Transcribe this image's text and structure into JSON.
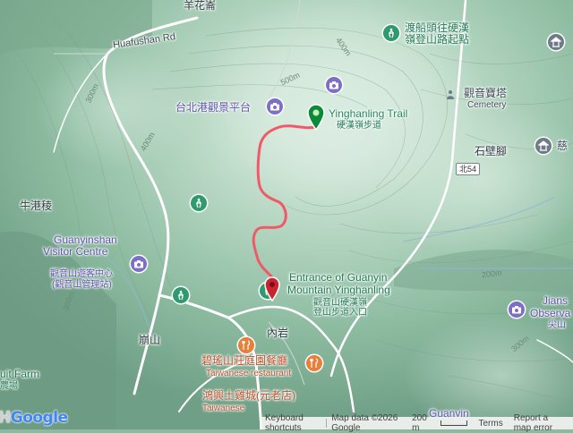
{
  "map": {
    "area_names": {
      "yanghua": "羊花崙",
      "niugang": "牛港稜",
      "shishan": "石壁腳",
      "bengshan": "崩山",
      "neiyan": "內岩"
    },
    "roads": {
      "huafushan_rd": "Huafushan Rd",
      "route_54": "北54"
    },
    "contours": [
      "500m",
      "400m",
      "300m",
      "400m",
      "300m",
      "300m",
      "400m",
      "200m",
      "300m"
    ],
    "pois": {
      "ferry_trailhead_line1": "渡船頭往硬漢",
      "ferry_trailhead_line2": "嶺登山路起點",
      "guanyin_tower": "觀音寶塔",
      "guanyin_tower_cemetery": "Cemetery",
      "taipei_port_platform": "台北港觀景平台",
      "yinghanling_trail_en": "Yinghanling Trail",
      "yinghanling_trail_zh": "硬漢嶺步道",
      "ci_partial": "慈",
      "visitor_centre_en1": "Guanyinshan",
      "visitor_centre_en2": "Visitor Centre",
      "visitor_centre_zh1": "觀音山遊客中心",
      "visitor_centre_zh2": "(觀音山管理站)",
      "entrance_en1": "Entrance of Guanyin",
      "entrance_en2": "Mountain Yinghanling",
      "entrance_zh1": "觀音山硬漢嶺",
      "entrance_zh2": "登山步道入口",
      "jianshi_line1": "Jians",
      "jianshi_line2": "Observa",
      "jianshi_zh": "尖山",
      "biyao_zh": "碧瑤山莊庭園餐廳",
      "biyao_en": "Taiwanese restaurant",
      "fruit_farm": "uit Farm",
      "fruit_farm_zh": "農場",
      "hongxing_partial": "鴻興土雞城(元老店)",
      "hongxing_sub": "Taiwanese",
      "guanyin_bottom": "Guanyin"
    },
    "attribution": {
      "shortcuts": "Keyboard shortcuts",
      "data": "Map data ©2026 Google",
      "scale": "200 m",
      "terms": "Terms",
      "report": "Report a map error"
    },
    "logo": "Google",
    "logo_prefix": "H"
  },
  "colors": {
    "terrain_high": "#dfeee4",
    "terrain_mid": "#a9cdb6",
    "terrain_low": "#6f9f86",
    "route": "#f05a67",
    "road": "#ffffff",
    "poi_blue": "#7e6fc6",
    "poi_green": "#2f9a6e"
  },
  "icons": {
    "start_pin": "green-start-marker-icon",
    "end_pin": "red-end-marker-icon",
    "photo": "camera-icon",
    "hiking": "hiking-icon",
    "restaurant": "fork-knife-icon",
    "temple": "temple-icon"
  }
}
